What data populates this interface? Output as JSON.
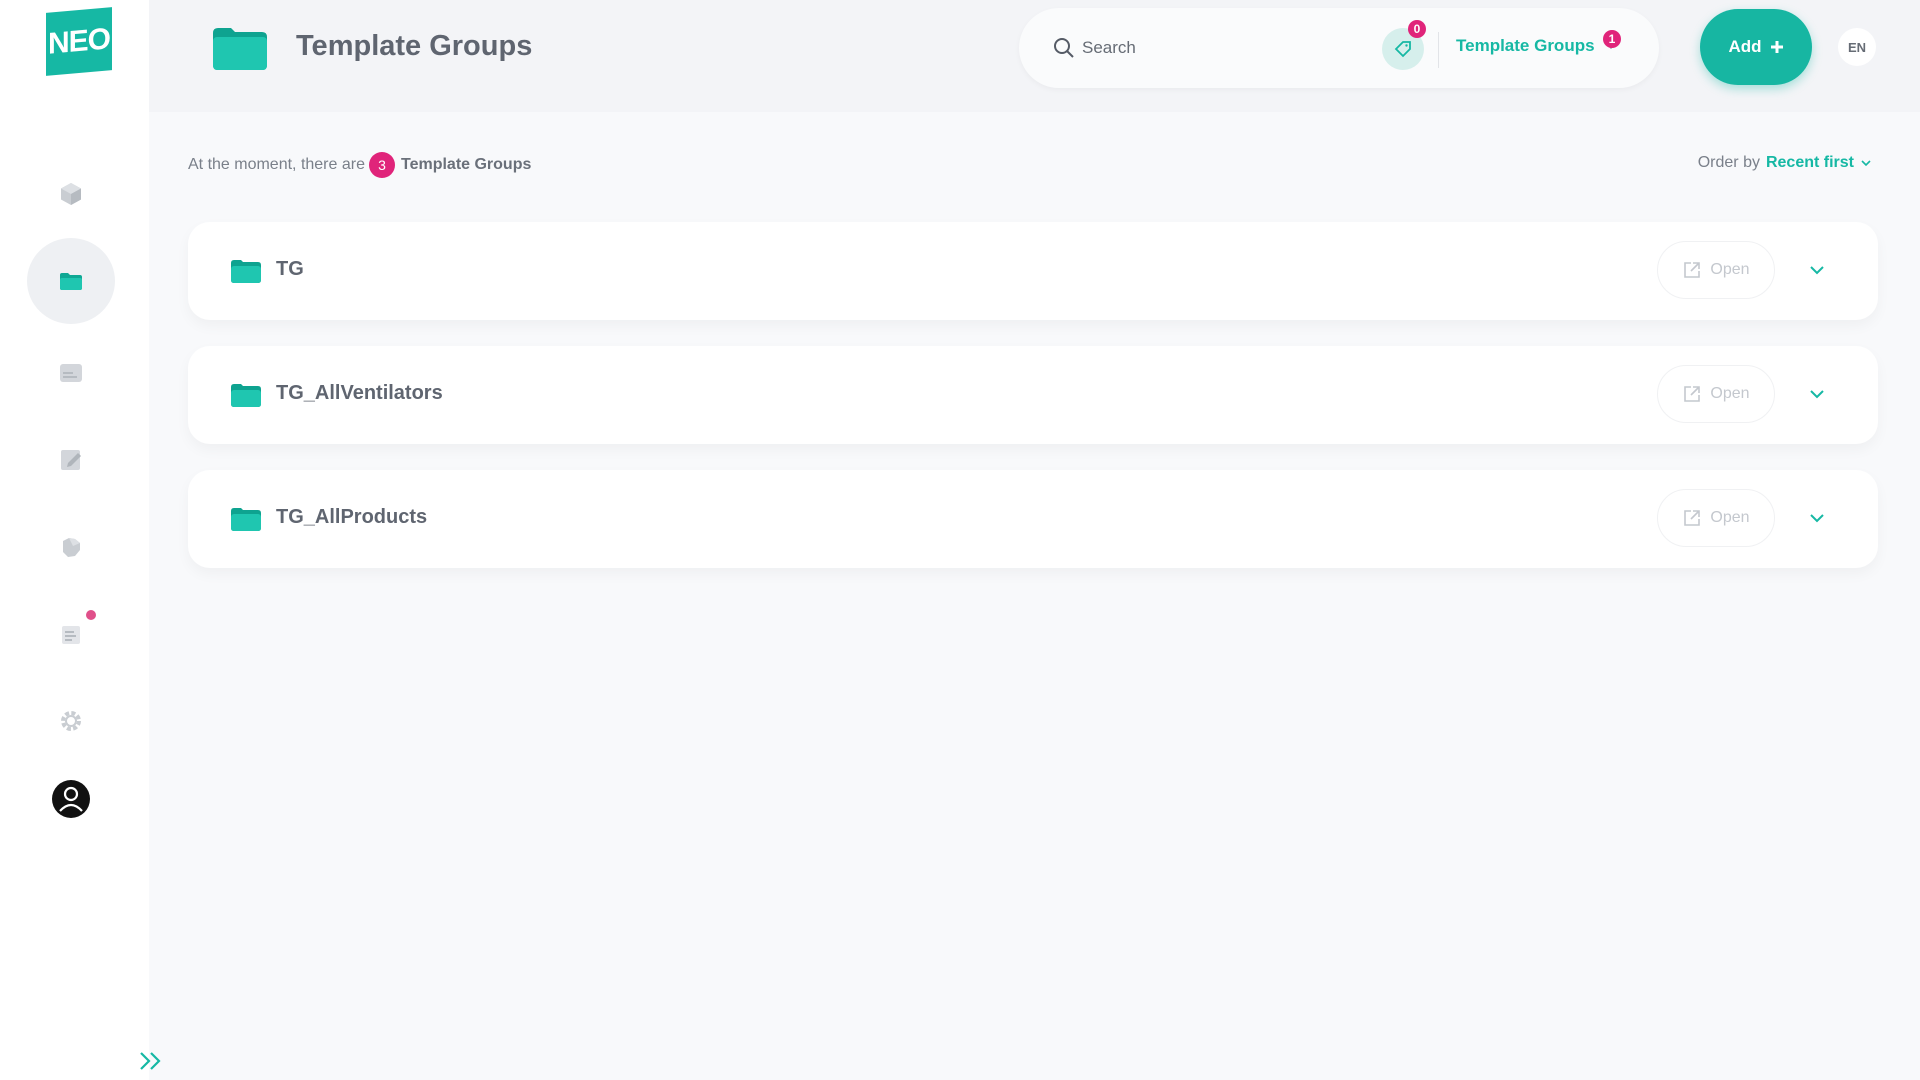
{
  "colors": {
    "accent": "#16b8a4",
    "badge": "#e0247a",
    "muted": "#7a808a"
  },
  "sidebar": {
    "logo_text": "NEO",
    "items": [
      {
        "id": "products",
        "icon": "cube-icon",
        "active": false
      },
      {
        "id": "template-groups",
        "icon": "folder-icon",
        "active": true
      },
      {
        "id": "templates",
        "icon": "card-icon",
        "active": false
      },
      {
        "id": "edit",
        "icon": "edit-icon",
        "active": false
      },
      {
        "id": "integrations",
        "icon": "puzzle-icon",
        "active": false
      },
      {
        "id": "logs",
        "icon": "document-list-icon",
        "active": false,
        "has_notification": true
      },
      {
        "id": "settings",
        "icon": "gear-icon",
        "active": false
      },
      {
        "id": "profile",
        "icon": "user-avatar-icon",
        "active": false
      }
    ],
    "expand_icon": "double-chevron-right-icon"
  },
  "header": {
    "title": "Template Groups",
    "search": {
      "placeholder": "Search",
      "value": ""
    },
    "tag_count": "0",
    "scope": {
      "label": "Template Groups",
      "badge": "1"
    },
    "add_label": "Add",
    "language": "EN"
  },
  "summary": {
    "prefix": "At the moment, there are",
    "count": "3",
    "entity": "Template Groups"
  },
  "order": {
    "label": "Order by",
    "value": "Recent first"
  },
  "groups": [
    {
      "name": "TG",
      "open_label": "Open"
    },
    {
      "name": "TG_AllVentilators",
      "open_label": "Open"
    },
    {
      "name": "TG_AllProducts",
      "open_label": "Open"
    }
  ]
}
